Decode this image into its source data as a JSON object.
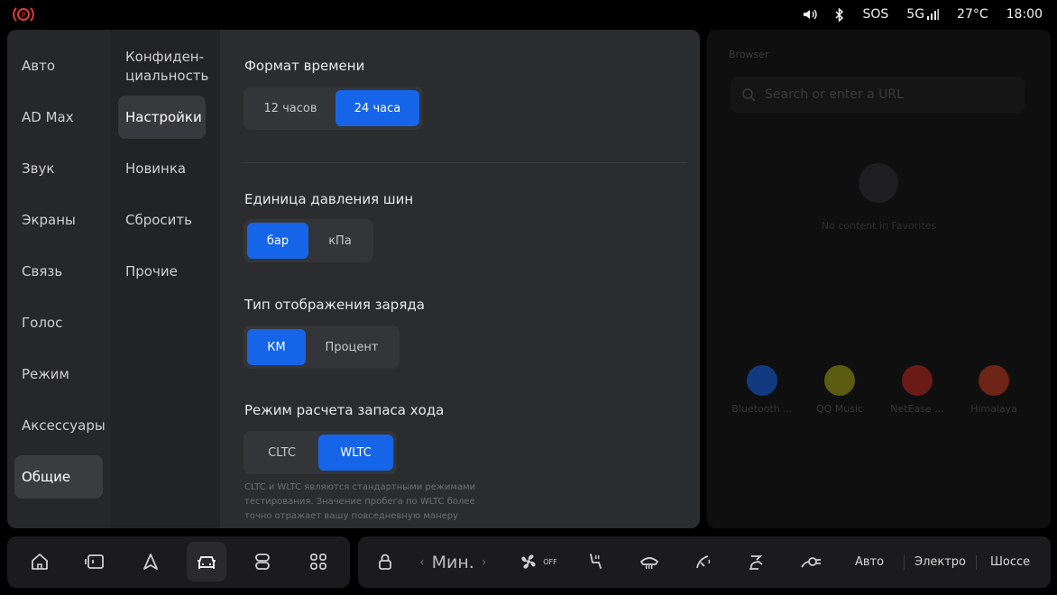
{
  "status": {
    "sos": "SOS",
    "network": "5G",
    "temperature": "27°C",
    "time": "18:00",
    "icons": [
      "parking-brake-icon",
      "volume-icon",
      "bluetooth-icon",
      "signal-icon"
    ]
  },
  "colors": {
    "accent": "#1665e8",
    "panel": "#262729",
    "background": "#000000"
  },
  "nav_primary": [
    "Авто",
    "AD Max",
    "Звук",
    "Экраны",
    "Связь",
    "Голос",
    "Режим",
    "Аксессуары",
    "Общие"
  ],
  "nav_primary_active": "Общие",
  "nav_secondary": {
    "privacy": "Конфиден-\nциальность",
    "settings": "Настройки",
    "new": "Новинка",
    "reset": "Сбросить",
    "other": "Прочие"
  },
  "nav_secondary_active": "Настройки",
  "settings": {
    "time_format": {
      "title": "Формат времени",
      "opt1": "12 часов",
      "opt2": "24 часа",
      "selected": "24 часа"
    },
    "tire_pressure": {
      "title": "Единица давления шин",
      "opt1": "бар",
      "opt2": "кПа",
      "selected": "бар"
    },
    "charge_display": {
      "title": "Тип отображения заряда",
      "opt1": "КМ",
      "opt2": "Процент",
      "selected": "КМ"
    },
    "range_mode": {
      "title": "Режим расчета запаса хода",
      "opt1": "CLTC",
      "opt2": "WLTC",
      "selected": "WLTC"
    },
    "note": "CLTC и WLTC являются стандартными режимами тестирования. Значение пробега по WLTC более точно отражает вашу повседневную манеру"
  },
  "browser": {
    "title": "Browser",
    "search_placeholder": "Search or enter a URL",
    "empty": "No content in Favorites",
    "apps": [
      "Bluetooth ...",
      "QQ Music",
      "NetEase ...",
      "Himalaya"
    ]
  },
  "dock": {
    "fan_speed": "Мин.",
    "fan_state": "OFF",
    "modes": [
      "Авто",
      "Электро",
      "Шоссе"
    ]
  }
}
